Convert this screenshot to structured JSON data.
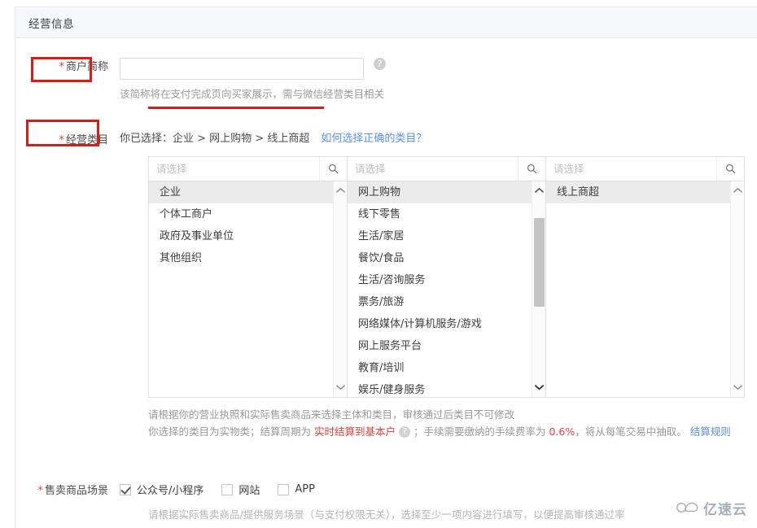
{
  "panel": {
    "header_title": "经营信息"
  },
  "merchant": {
    "label": "商户简称",
    "required_mark": "*",
    "input_value": "",
    "input_placeholder": "",
    "help_icon": "question-mark-icon",
    "hint": "该简称将在支付完成页向买家展示，需与微信经营类目相关"
  },
  "category": {
    "label": "经营类目",
    "required_mark": "*",
    "selected_prefix": "你已选择：",
    "selected_path": "企业 > 网上购物 > 线上商超",
    "help_link": "如何选择正确的类目？",
    "columns": [
      {
        "search_placeholder": "请选择",
        "search_icon": "search-icon",
        "items": [
          "企业",
          "个体工商户",
          "政府及事业单位",
          "其他组织"
        ],
        "selected_index": 0,
        "scrollbar": {
          "thumb_top_pct": 0,
          "thumb_height_pct": 0
        }
      },
      {
        "search_placeholder": "请选择",
        "search_icon": "search-icon",
        "items": [
          "网上购物",
          "线下零售",
          "生活/家居",
          "餐饮/食品",
          "生活/咨询服务",
          "票务/旅游",
          "网络媒体/计算机服务/游戏",
          "网上服务平台",
          "教育/培训",
          "娱乐/健身服务"
        ],
        "selected_index": 0,
        "scrollbar": {
          "thumb_top_pct": 11,
          "thumb_height_pct": 47
        }
      },
      {
        "search_placeholder": "请选择",
        "search_icon": "search-icon",
        "items": [
          "线上商超"
        ],
        "selected_index": 0,
        "scrollbar": {
          "thumb_top_pct": 0,
          "thumb_height_pct": 0
        }
      }
    ],
    "notes": {
      "line1": "请根据你的营业执照和实际售卖商品来选择主体和类目，审核通过后类目不可修改",
      "line2_part1": "你选择的类目为实物类；结算周期为 ",
      "line2_highlight": "实时结算到基本户",
      "line2_help_icon": "question-mark-icon",
      "line2_part2": "；手续需要缴纳的手续费率为 ",
      "line2_rate": "0.6%",
      "line2_part3": "，将从每笔交易中抽取。 ",
      "line2_link": "结算规则"
    }
  },
  "scene": {
    "label": "售卖商品场景",
    "required_mark": "*",
    "options": [
      {
        "label": "公众号/小程序",
        "checked": true
      },
      {
        "label": "网站",
        "checked": false
      },
      {
        "label": "APP",
        "checked": false
      }
    ],
    "hint": "请根据实际售卖商品/提供服务场景（与支付权限无关），选择至少一项内容进行填写，以便提高审核通过率"
  },
  "watermark": {
    "icon": "cloud-icon",
    "text": "亿速云"
  },
  "colors": {
    "accent_red": "#d81c18",
    "link_blue": "#5b8ff0",
    "required_red": "#e8403a",
    "header_bg": "#f6f8fb"
  }
}
